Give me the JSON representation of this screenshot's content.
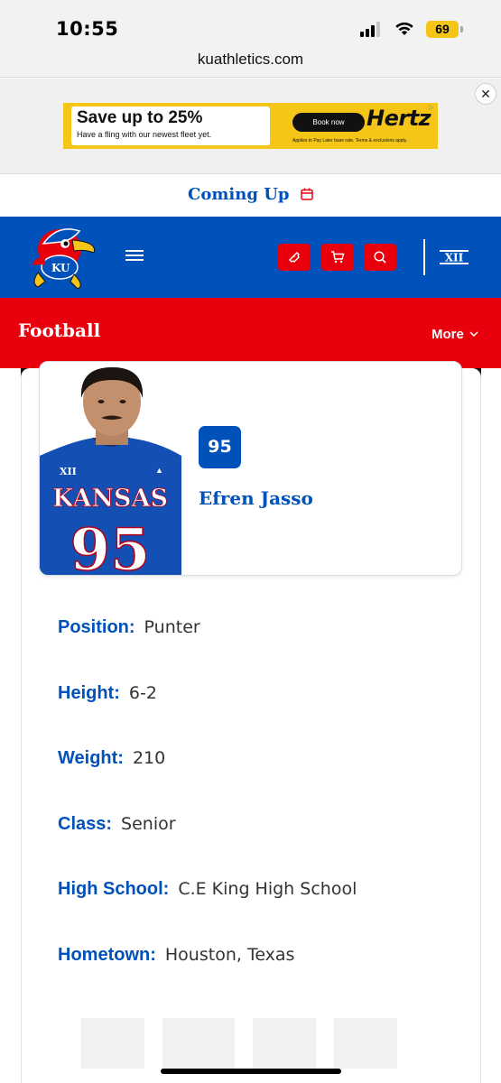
{
  "status_bar": {
    "time": "10:55",
    "battery": "69"
  },
  "browser": {
    "url": "kuathletics.com"
  },
  "ad": {
    "headline": "Save up to 25%",
    "subline": "Have a fling with our newest fleet yet.",
    "cta": "Book now",
    "brand": "Hertz",
    "fine_print": "Applies to Pay Later base rate. Terms & exclusions apply.",
    "close": "✕"
  },
  "coming_up": {
    "label": "Coming Up"
  },
  "header": {
    "icons": [
      "kansas-jayhawk-logo",
      "menu-icon",
      "ticket-icon",
      "cart-icon",
      "search-icon",
      "big-12-logo"
    ]
  },
  "section": {
    "title": "Football",
    "more_label": "More"
  },
  "player": {
    "number": "95",
    "name": "Efren Jasso",
    "jersey_text": "KANSAS",
    "jersey_number": "95"
  },
  "bio": [
    {
      "label": "Position:",
      "value": "Punter"
    },
    {
      "label": "Height:",
      "value": "6-2"
    },
    {
      "label": "Weight:",
      "value": "210"
    },
    {
      "label": "Class:",
      "value": "Senior"
    },
    {
      "label": "High School:",
      "value": "C.E King High School"
    },
    {
      "label": "Hometown:",
      "value": "Houston, Texas"
    }
  ],
  "colors": {
    "ku_blue": "#0051ba",
    "ku_red": "#e8000d",
    "ad_yellow": "#f5c518"
  }
}
